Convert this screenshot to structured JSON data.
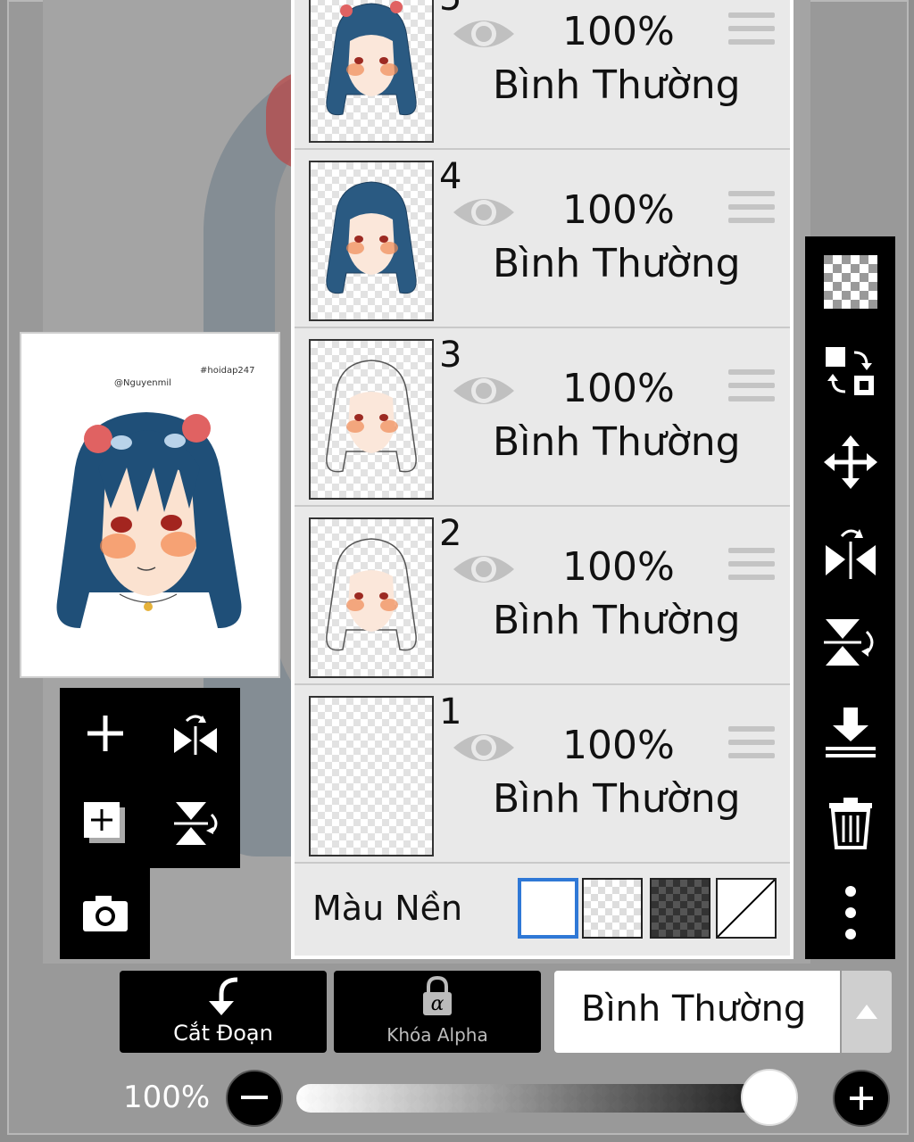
{
  "preview": {
    "watermark_left": "@Nguyenmil",
    "watermark_right": "#hoidap247"
  },
  "layers": [
    {
      "number": "5",
      "opacity": "100%",
      "blend": "Bình Thường",
      "visible": true
    },
    {
      "number": "4",
      "opacity": "100%",
      "blend": "Bình Thường",
      "visible": true
    },
    {
      "number": "3",
      "opacity": "100%",
      "blend": "Bình Thường",
      "visible": true
    },
    {
      "number": "2",
      "opacity": "100%",
      "blend": "Bình Thường",
      "visible": true
    },
    {
      "number": "1",
      "opacity": "100%",
      "blend": "Bình Thường",
      "visible": true
    }
  ],
  "background": {
    "label": "Màu Nền",
    "selected": "white",
    "options": [
      "white",
      "transparent",
      "dark-checker",
      "none"
    ],
    "selected_color": "#2f78d6"
  },
  "left_tools": [
    "add-layer-icon",
    "flip-horizontal-icon",
    "add-copy-layer-icon",
    "flip-vertical-icon",
    "camera-icon"
  ],
  "right_tools": [
    "transparency-icon",
    "swap-icon",
    "move-icon",
    "flip-horizontal-icon",
    "flip-vertical-icon",
    "merge-down-icon",
    "trash-icon",
    "more-icon"
  ],
  "bottom": {
    "clip_label": "Cắt Đoạn",
    "alpha_label": "Khóa Alpha",
    "blend_mode": "Bình Thường"
  },
  "opacity": {
    "readout": "100%",
    "value": 1.0
  },
  "colors": {
    "panel": "#e9e9e9",
    "toolbar": "#000000",
    "accent": "#2f78d6"
  }
}
